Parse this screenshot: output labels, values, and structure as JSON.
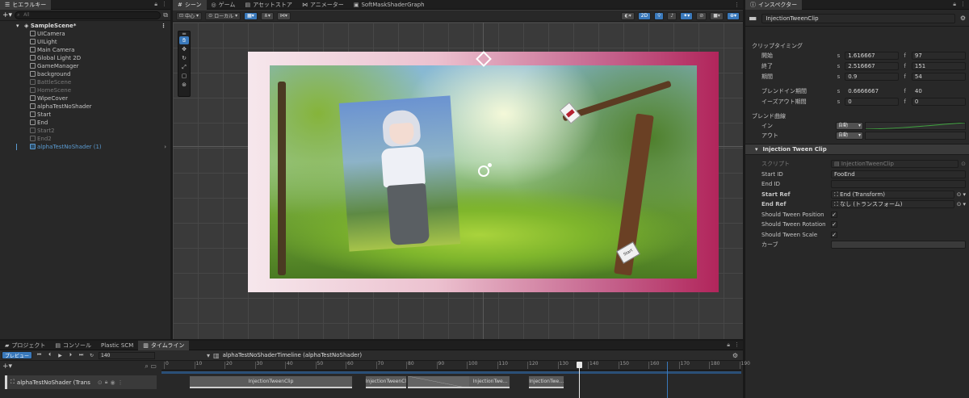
{
  "hierarchy": {
    "tab": "ヒエラルキー",
    "search_placeholder": "All",
    "scene": "SampleScene*",
    "items": [
      {
        "label": "UICamera",
        "style": "normal"
      },
      {
        "label": "UILight",
        "style": "normal"
      },
      {
        "label": "Main Camera",
        "style": "normal"
      },
      {
        "label": "Global Light 2D",
        "style": "normal"
      },
      {
        "label": "GameManager",
        "style": "normal"
      },
      {
        "label": "background",
        "style": "normal"
      },
      {
        "label": "BattleScene",
        "style": "dim"
      },
      {
        "label": "HomeScene",
        "style": "dim"
      },
      {
        "label": "WipeCover",
        "style": "normal"
      },
      {
        "label": "alphaTestNoShader",
        "style": "normal"
      },
      {
        "label": "Start",
        "style": "normal"
      },
      {
        "label": "End",
        "style": "normal"
      },
      {
        "label": "Start2",
        "style": "dim"
      },
      {
        "label": "End2",
        "style": "dim"
      },
      {
        "label": "alphaTestNoShader (1)",
        "style": "prefab"
      }
    ]
  },
  "scene": {
    "tabs": [
      "シーン",
      "ゲーム",
      "アセットストア",
      "アニメーター",
      "SoftMaskShaderGraph"
    ],
    "pivot": "中心",
    "space": "ローカル",
    "mode_2d": "2D",
    "start_marker": "Start"
  },
  "inspector": {
    "tab": "インスペクター",
    "name": "InjectionTweenClip",
    "clip_timing": "クリップタイミング",
    "start": {
      "label": "開始",
      "s": "1.616667",
      "f": "97"
    },
    "end": {
      "label": "終了",
      "s": "2.516667",
      "f": "151"
    },
    "duration": {
      "label": "期間",
      "s": "0.9",
      "f": "54"
    },
    "blend_in_duration": {
      "label": "ブレンドイン期間",
      "s": "0.6666667",
      "f": "40"
    },
    "ease_out_duration": {
      "label": "イーズアウト期間",
      "s": "0",
      "f": "0"
    },
    "unit_s": "s",
    "unit_f": "f",
    "blend_curves": "ブレンド曲線",
    "in": {
      "label": "イン",
      "value": "自動"
    },
    "out": {
      "label": "アウト",
      "value": "自動"
    },
    "component": "Injection Tween Clip",
    "script": {
      "label": "スクリプト",
      "value": "InjectionTweenClip"
    },
    "start_id": {
      "label": "Start ID",
      "value": "FooEnd"
    },
    "end_id": {
      "label": "End ID",
      "value": ""
    },
    "start_ref": {
      "label": "Start Ref",
      "value": "End (Transform)"
    },
    "end_ref": {
      "label": "End Ref",
      "value": "なし (トランスフォーム)"
    },
    "tween_position": {
      "label": "Should Tween Position",
      "checked": true
    },
    "tween_rotation": {
      "label": "Should Tween Rotation",
      "checked": true
    },
    "tween_scale": {
      "label": "Should Tween Scale",
      "checked": true
    },
    "curve": {
      "label": "カーブ"
    }
  },
  "bottom": {
    "tabs": [
      "プロジェクト",
      "コンソール",
      "Plastic SCM",
      "タイムライン"
    ],
    "preview": "プレビュー",
    "frame": "140",
    "timeline_asset": "alphaTestNoShaderTimeline (alphaTestNoShader)",
    "track": "alphaTestNoShader (Trans",
    "ruler": [
      "0",
      "10",
      "20",
      "30",
      "40",
      "50",
      "60",
      "70",
      "80",
      "90",
      "100",
      "110",
      "120",
      "130",
      "140",
      "150",
      "160",
      "170",
      "180",
      "190"
    ],
    "clips": [
      {
        "label": "InjectionTweenClip",
        "start": 3,
        "end": 57
      },
      {
        "label": "InjectionTweenClip",
        "start": 61,
        "end": 75
      },
      {
        "label": "InjectionTwe…",
        "start": 75,
        "end": 109
      },
      {
        "label": "InjectionTwe…",
        "start": 115,
        "end": 127
      }
    ],
    "playhead_frame": 140
  }
}
